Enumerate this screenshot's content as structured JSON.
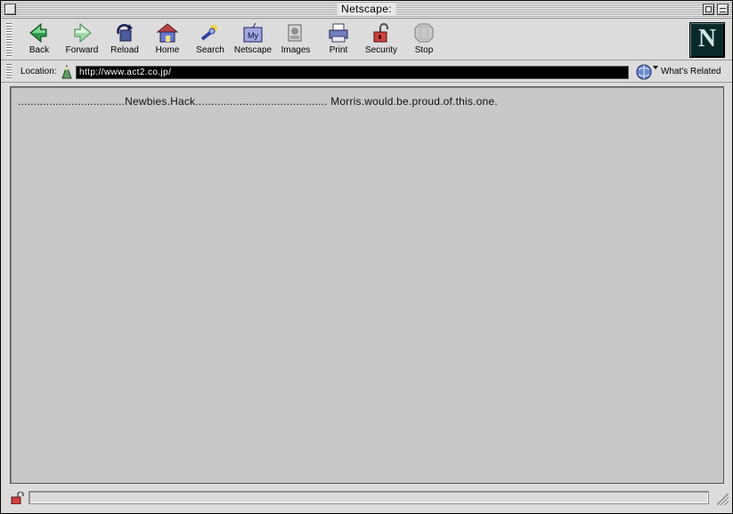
{
  "window": {
    "title": "Netscape:"
  },
  "toolbar": {
    "buttons": [
      {
        "label": "Back",
        "icon": "back-arrow-icon"
      },
      {
        "label": "Forward",
        "icon": "forward-arrow-icon"
      },
      {
        "label": "Reload",
        "icon": "reload-icon"
      },
      {
        "label": "Home",
        "icon": "home-icon"
      },
      {
        "label": "Search",
        "icon": "search-icon"
      },
      {
        "label": "Netscape",
        "icon": "my-netscape-icon"
      },
      {
        "label": "Images",
        "icon": "images-icon"
      },
      {
        "label": "Print",
        "icon": "printer-icon"
      },
      {
        "label": "Security",
        "icon": "padlock-icon"
      },
      {
        "label": "Stop",
        "icon": "stop-icon"
      }
    ],
    "brand_letter": "N"
  },
  "location": {
    "label": "Location:",
    "url": "http://www.act2.co.jp/",
    "related_label": "What's Related"
  },
  "content": {
    "text": "..................................Newbies.Hack.......................................... Morris.would.be.proud.of.this.one."
  },
  "status": {
    "text": ""
  },
  "colors": {
    "window_bg": "#dcdcdc",
    "content_bg": "#c8c8c8",
    "url_field_bg": "#000000",
    "url_text": "#ffffff",
    "logo_bg": "#0a2a2a"
  }
}
